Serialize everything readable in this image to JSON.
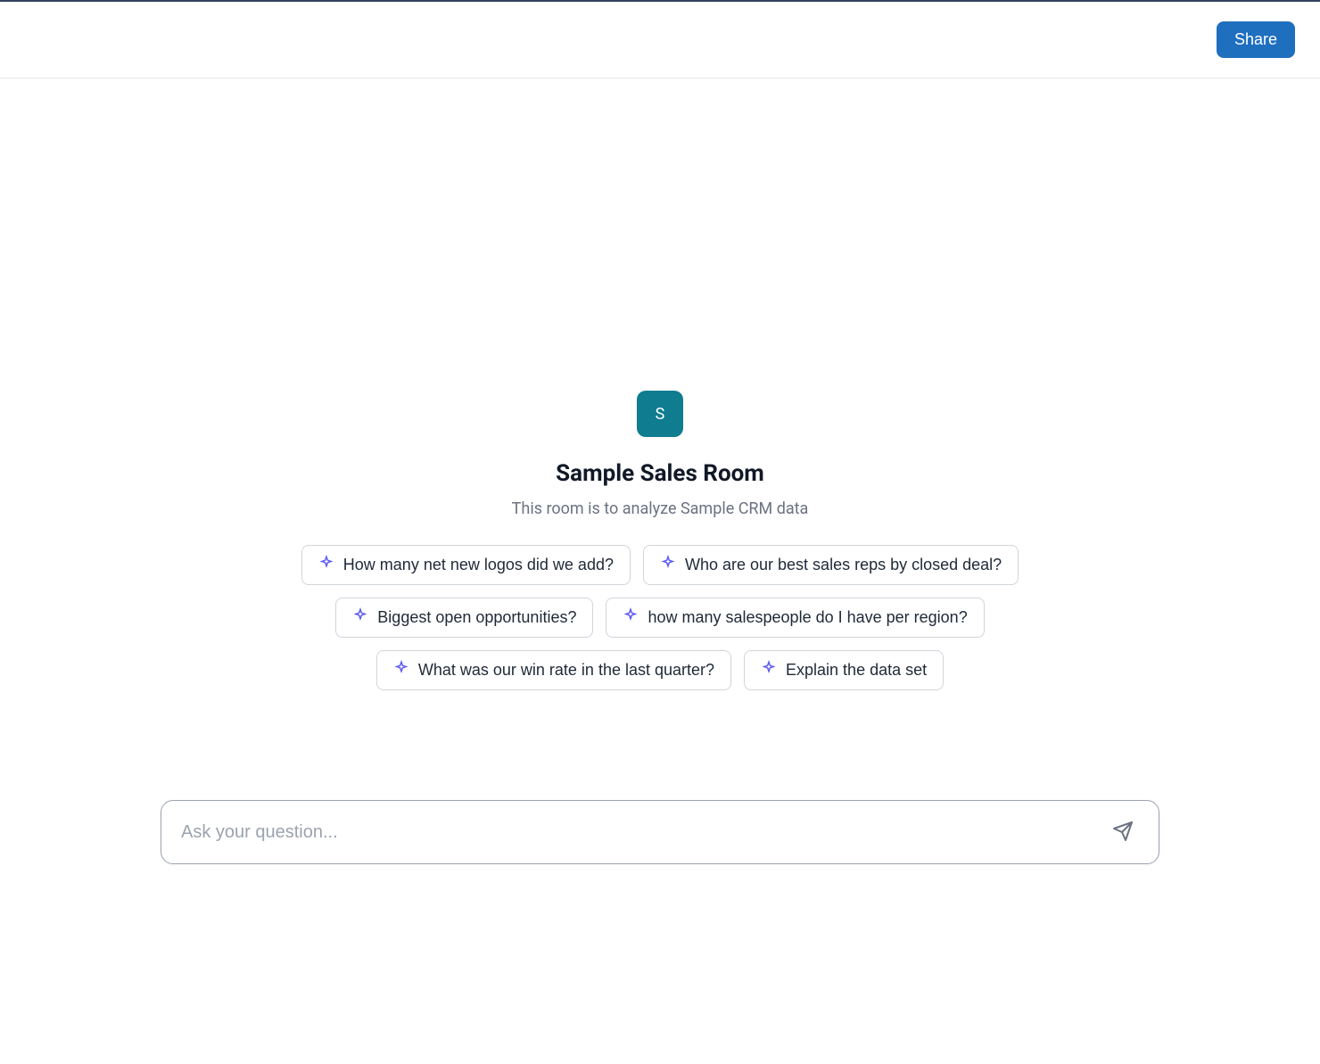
{
  "header": {
    "share_label": "Share"
  },
  "room": {
    "avatar_letter": "S",
    "title": "Sample Sales Room",
    "subtitle": "This room is to analyze Sample CRM data"
  },
  "suggestions": [
    "How many net new logos did we add?",
    "Who are our best sales reps by closed deal?",
    "Biggest open opportunities?",
    "how many salespeople do I have per region?",
    "What was our win rate in the last quarter?",
    "Explain the data set"
  ],
  "input": {
    "placeholder": "Ask your question...",
    "value": ""
  }
}
